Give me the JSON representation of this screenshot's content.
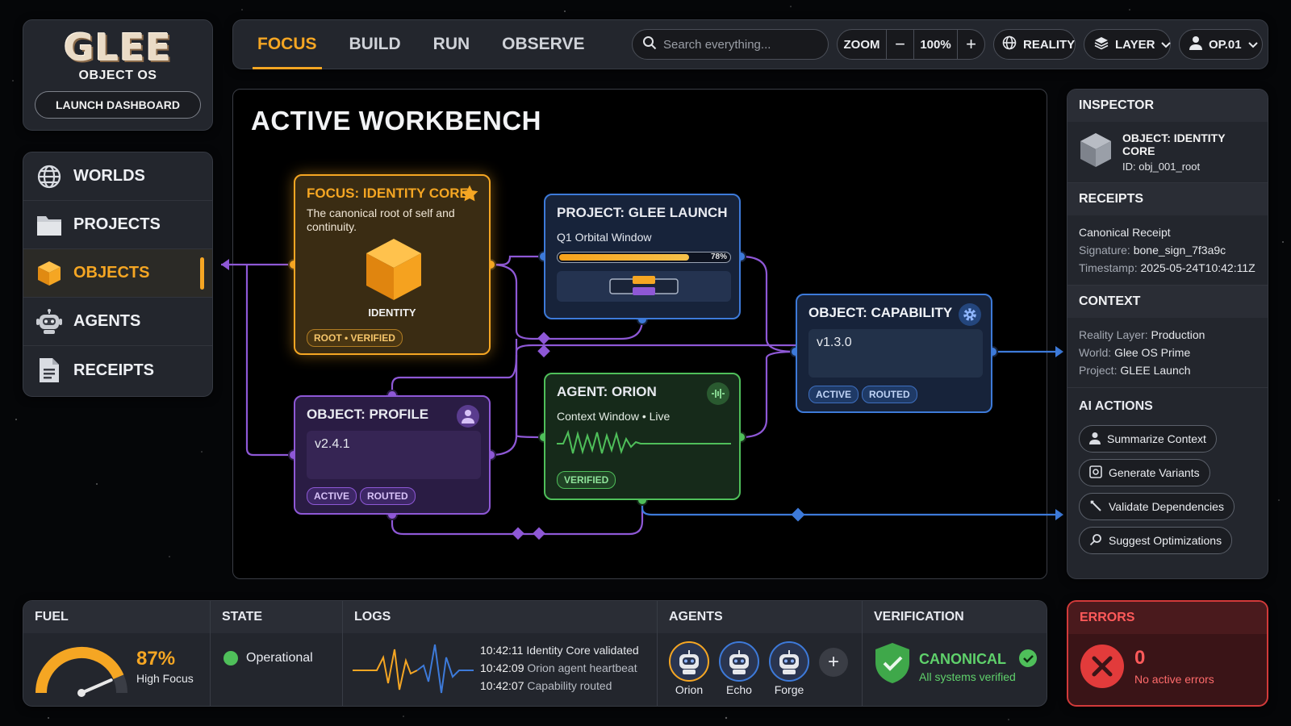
{
  "brand": {
    "logo": "GLEE",
    "subtitle": "OBJECT OS",
    "launch_label": "LAUNCH DASHBOARD"
  },
  "sidebar": {
    "items": [
      {
        "label": "WORLDS",
        "icon": "globe-icon"
      },
      {
        "label": "PROJECTS",
        "icon": "folder-icon"
      },
      {
        "label": "OBJECTS",
        "icon": "cube-icon",
        "active": true
      },
      {
        "label": "AGENTS",
        "icon": "robot-icon"
      },
      {
        "label": "RECEIPTS",
        "icon": "document-icon"
      }
    ]
  },
  "topbar": {
    "tabs": [
      "FOCUS",
      "BUILD",
      "RUN",
      "OBSERVE"
    ],
    "active_tab": "FOCUS",
    "search_placeholder": "Search everything...",
    "zoom_label": "ZOOM",
    "zoom_minus": "−",
    "zoom_value": "100%",
    "zoom_plus": "+",
    "reality_label": "REALITY",
    "layer_label": "LAYER",
    "user_label": "OP.01"
  },
  "workbench": {
    "title": "ACTIVE WORKBENCH",
    "focus_node": {
      "title": "FOCUS: IDENTITY CORE",
      "description": "The canonical root of self and continuity.",
      "cube_label": "IDENTITY",
      "badge": "ROOT • VERIFIED"
    },
    "project_node": {
      "title": "PROJECT: GLEE LAUNCH",
      "subtitle": "Q1 Orbital Window",
      "progress": 78,
      "progress_text": "78%"
    },
    "capability_node": {
      "title": "OBJECT: CAPABILITY",
      "version": "v1.3.0",
      "badges": [
        "ACTIVE",
        "ROUTED"
      ]
    },
    "profile_node": {
      "title": "OBJECT: PROFILE",
      "version": "v2.4.1",
      "badges": [
        "ACTIVE",
        "ROUTED"
      ]
    },
    "agent_node": {
      "title": "AGENT: ORION",
      "subtitle": "Context Window • Live",
      "badge": "VERIFIED"
    }
  },
  "inspector": {
    "title": "INSPECTOR",
    "object_name": "OBJECT: IDENTITY CORE",
    "object_id": "ID: obj_001_root",
    "receipts_title": "RECEIPTS",
    "receipt_name": "Canonical Receipt",
    "signature_key": "Signature:",
    "signature_val": "bone_sign_7f3a9c",
    "timestamp_key": "Timestamp:",
    "timestamp_val": "2025-05-24T10:42:11Z",
    "context_title": "CONTEXT",
    "reality_key": "Reality Layer:",
    "reality_val": "Production",
    "world_key": "World:",
    "world_val": "Glee OS Prime",
    "project_key": "Project:",
    "project_val": "GLEE Launch",
    "ai_title": "AI ACTIONS",
    "ai_actions": [
      "Summarize Context",
      "Generate Variants",
      "Validate Dependencies",
      "Suggest Optimizations"
    ]
  },
  "status": {
    "fuel_title": "FUEL",
    "fuel_value": "87%",
    "fuel_level": 87,
    "fuel_label": "High Focus",
    "state_title": "STATE",
    "state_value": "Operational",
    "logs_title": "LOGS",
    "logs": [
      {
        "time": "10:42:11",
        "text": "Identity Core validated"
      },
      {
        "time": "10:42:09",
        "text": "Orion agent heartbeat"
      },
      {
        "time": "10:42:07",
        "text": "Capability routed"
      }
    ],
    "agents_title": "AGENTS",
    "agents": [
      "Orion",
      "Echo",
      "Forge"
    ],
    "add_agent": "+",
    "verification_title": "VERIFICATION",
    "verification_value": "CANONICAL",
    "verification_sub": "All systems verified",
    "errors_title": "ERRORS",
    "errors_count": "0",
    "errors_sub": "No active errors"
  },
  "colors": {
    "accent": "#f5a623",
    "blue": "#3d7ad9",
    "purple": "#8e58d6",
    "green": "#4fbf5a",
    "error": "#d23a3a"
  }
}
